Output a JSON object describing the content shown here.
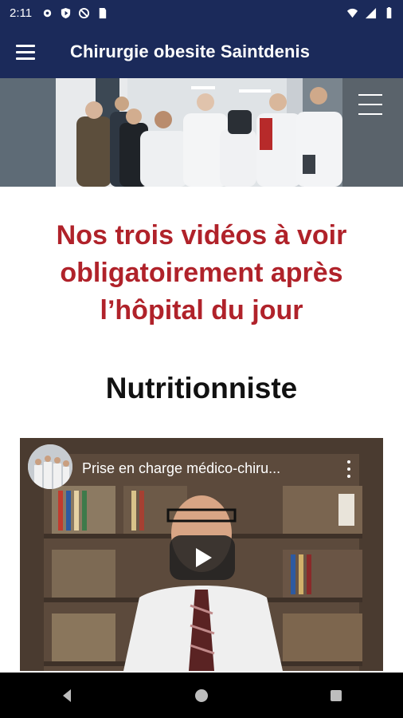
{
  "status_bar": {
    "time": "2:11",
    "icons_left": [
      "settings-icon",
      "shield-icon",
      "no-disturb-icon",
      "sim-icon"
    ],
    "icons_right": [
      "wifi-icon",
      "signal-icon",
      "battery-icon"
    ]
  },
  "app_bar": {
    "title": "Chirurgie obesite Saintdenis",
    "menu_icon": "hamburger-icon"
  },
  "hero": {
    "description_icon": "team-photo",
    "menu_icon": "hamburger-icon"
  },
  "content": {
    "headline_lines": [
      "Nos trois vidéos à voir",
      "obligatoirement après",
      "l’hôpital du jour"
    ],
    "section_title": "Nutritionniste",
    "video": {
      "title": "Prise en charge médico-chiru...",
      "play_icon": "play-icon",
      "more_icon": "more-vert-icon"
    }
  },
  "nav_bar": {
    "buttons": [
      "back-icon",
      "home-icon",
      "recents-icon"
    ]
  },
  "colors": {
    "primary": "#1b2a5a",
    "headline": "#b0222a"
  }
}
